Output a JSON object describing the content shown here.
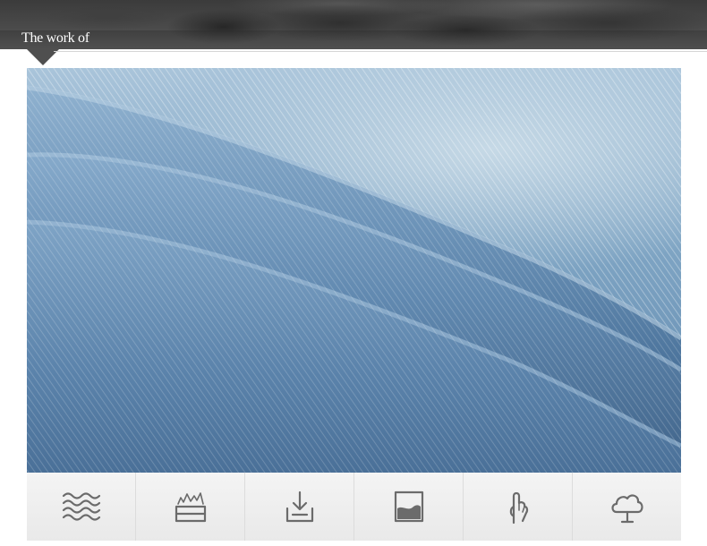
{
  "header": {
    "title": "The work of"
  },
  "photo": {
    "subject": "denim-fabric-folds",
    "colors": {
      "denim_light": "#c6d9e6",
      "denim_mid": "#7ea4c3",
      "denim_dark": "#4f78a0"
    }
  },
  "feature_icons": [
    {
      "icon": "water-waves-icon"
    },
    {
      "icon": "heat-tray-icon"
    },
    {
      "icon": "download-tray-icon"
    },
    {
      "icon": "fabric-swatch-icon"
    },
    {
      "icon": "hand-touch-icon"
    },
    {
      "icon": "cloud-tree-icon"
    }
  ],
  "colors": {
    "banner_bg": "#4a4a4a",
    "strip_bg": "#efefef",
    "icon_stroke": "#6b6b6b"
  }
}
